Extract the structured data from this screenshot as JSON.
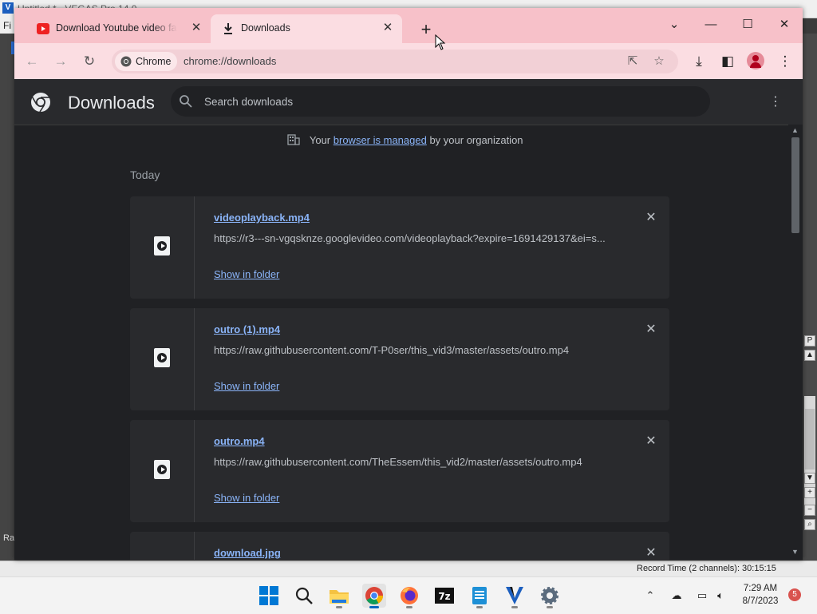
{
  "background_app": {
    "title": "Untitled * - VEGAS Pro 14.0",
    "menu_first": "Fi",
    "side_label": "Ra",
    "status": "Record Time (2 channels): 30:15:15"
  },
  "browser": {
    "tabs": [
      {
        "title": "Download Youtube video fast, c",
        "active": false
      },
      {
        "title": "Downloads",
        "active": true
      }
    ],
    "omnibox": {
      "chip_label": "Chrome",
      "url": "chrome://downloads"
    }
  },
  "downloads_page": {
    "title": "Downloads",
    "search_placeholder": "Search downloads",
    "managed_prefix": "Your",
    "managed_link": "browser is managed",
    "managed_suffix": "by your organization",
    "section_label": "Today",
    "show_in_folder_label": "Show in folder",
    "items": [
      {
        "filename": "videoplayback.mp4",
        "url": "https://r3---sn-vgqsknze.googlevideo.com/videoplayback?expire=1691429137&ei=s..."
      },
      {
        "filename": "outro (1).mp4",
        "url": "https://raw.githubusercontent.com/T-P0ser/this_vid3/master/assets/outro.mp4"
      },
      {
        "filename": "outro.mp4",
        "url": "https://raw.githubusercontent.com/TheEssem/this_vid2/master/assets/outro.mp4"
      },
      {
        "filename": "download.jpg",
        "url": ""
      }
    ]
  },
  "taskbar": {
    "apps": [
      "start-icon",
      "search-icon",
      "file-explorer-icon",
      "chrome-icon",
      "firefox-icon",
      "7zip-icon",
      "notepad-icon",
      "vegas-icon",
      "settings-icon"
    ],
    "time": "7:29 AM",
    "date": "8/7/2023",
    "notification_count": "5"
  },
  "colors": {
    "tabstrip": "#f7c1c9",
    "toolbar": "#fbdde2",
    "page_bg": "#202124",
    "card_bg": "#292a2d",
    "link": "#8ab4f8"
  }
}
